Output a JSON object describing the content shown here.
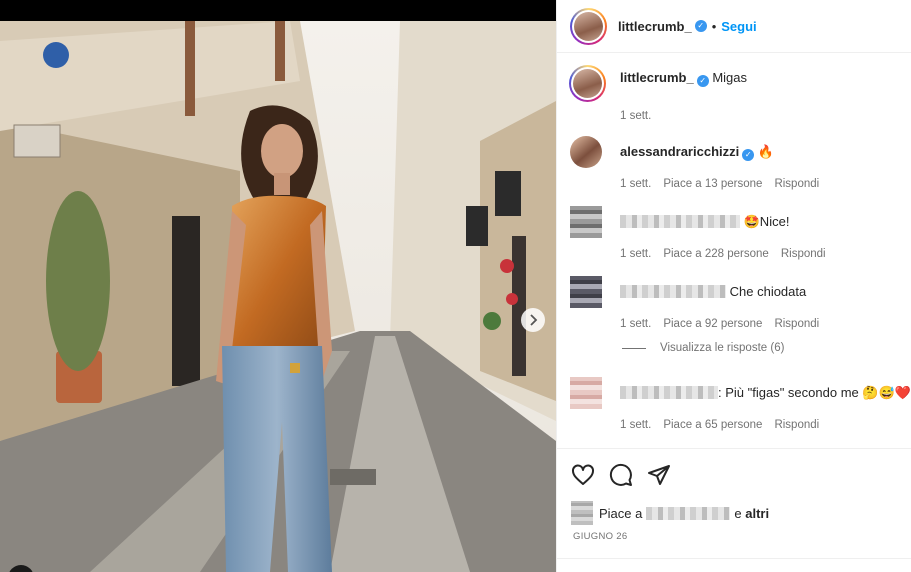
{
  "post": {
    "author": "littlecrumb_",
    "follow_label": "Segui",
    "separator": "•"
  },
  "caption": {
    "author": "littlecrumb_",
    "text": "Migas",
    "time": "1 sett."
  },
  "comments": [
    {
      "user": "alessandraricchizzi",
      "text": "🔥",
      "time": "1 sett.",
      "likes": "Piace a 13 persone",
      "reply": "Rispondi",
      "blurred": false
    },
    {
      "user": "",
      "text": "🤩Nice!",
      "time": "1 sett.",
      "likes": "Piace a 228 persone",
      "reply": "Rispondi",
      "blurred": true
    },
    {
      "user": "",
      "text": "Che chiodata",
      "time": "1 sett.",
      "likes": "Piace a 92 persone",
      "reply": "Rispondi",
      "blurred": true
    },
    {
      "user": "",
      "text": ": Più \"figas\" secondo me 🤔😅❤️",
      "time": "1 sett.",
      "likes": "Piace a 65 persone",
      "reply": "Rispondi",
      "blurred": true
    }
  ],
  "view_replies": "Visualizza le risposte (6)",
  "actions": {
    "likes_prefix": "Piace a",
    "likes_suffix": "e",
    "likes_others": "altri",
    "date": "GIUGNO 26"
  },
  "icons": [
    "verified-badge-icon",
    "heart-icon",
    "comment-icon",
    "share-icon",
    "chevron-right-icon",
    "user-tag-icon"
  ],
  "colors": {
    "accent": "#0095f6",
    "verified": "#3897f0",
    "muted": "#737373"
  }
}
